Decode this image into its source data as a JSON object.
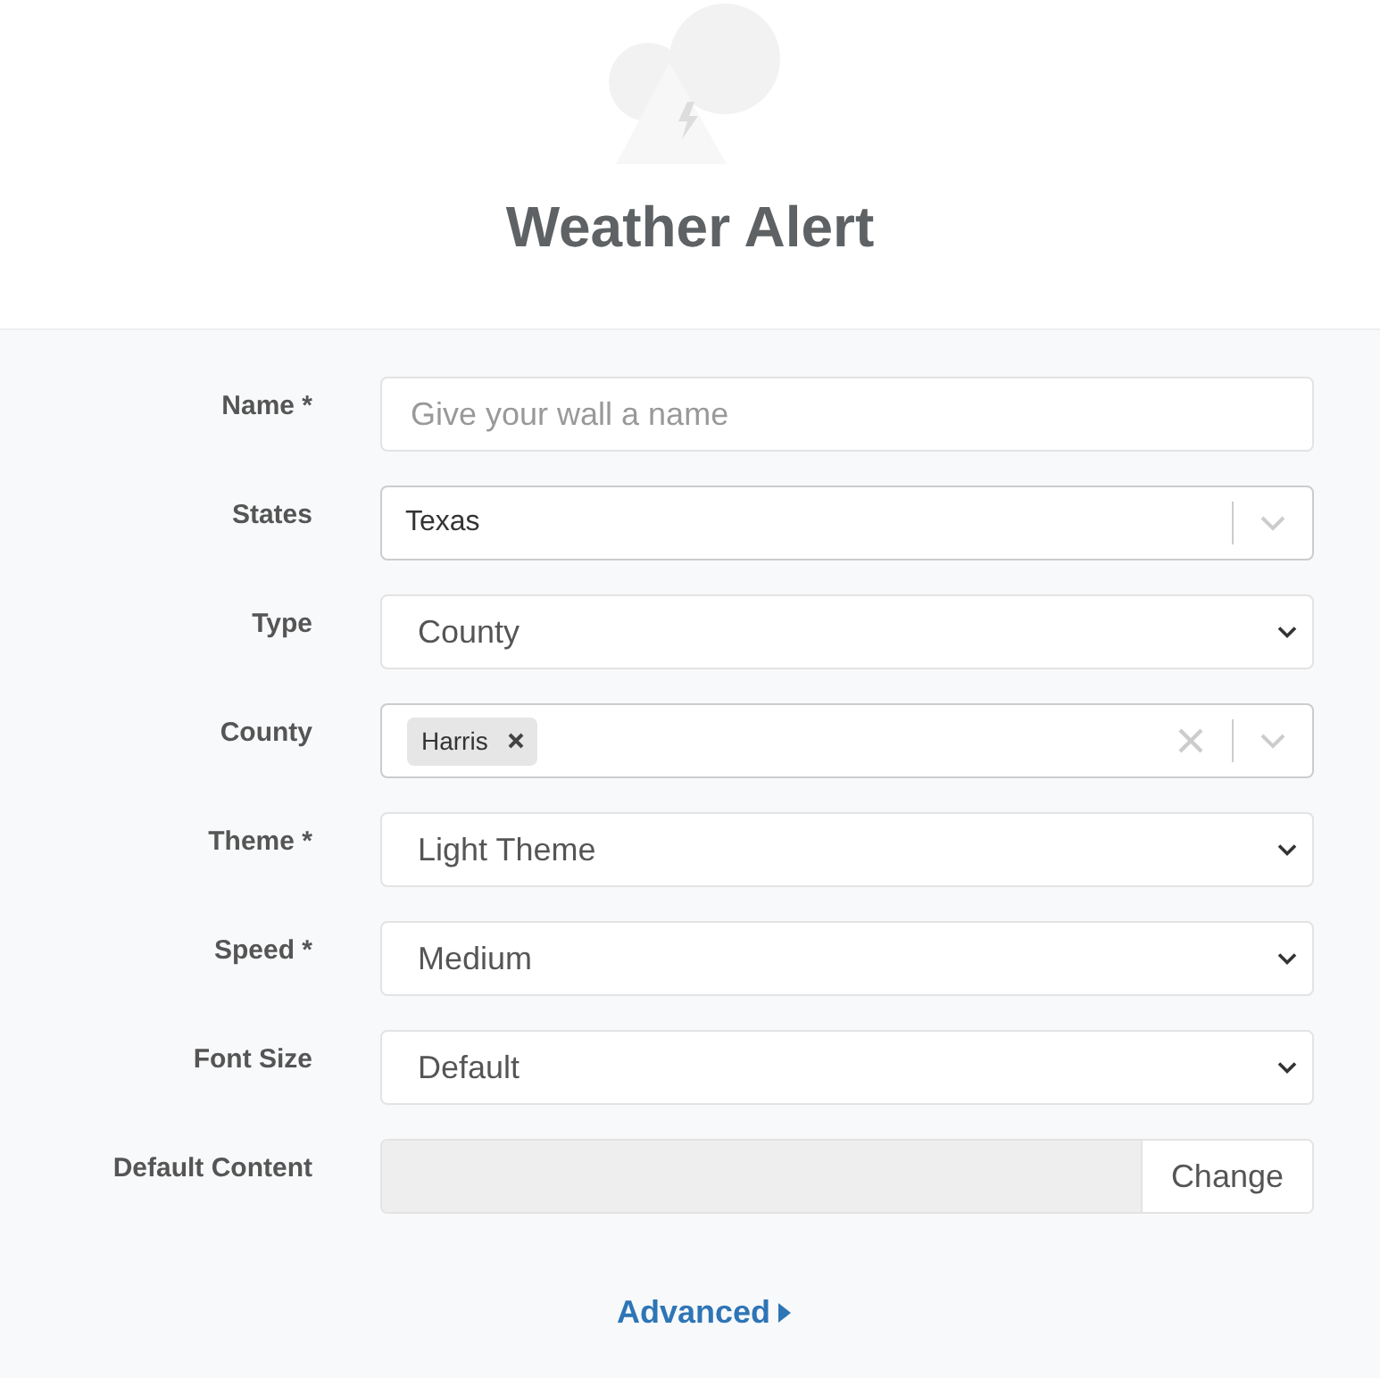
{
  "header": {
    "title": "Weather Alert"
  },
  "fields": [
    {
      "label": "Name *",
      "kind": "text",
      "placeholder": "Give your wall a name"
    },
    {
      "label": "States",
      "kind": "combo",
      "value": "Texas"
    },
    {
      "label": "Type",
      "kind": "select",
      "value": "County"
    },
    {
      "label": "County",
      "kind": "multi",
      "tags": [
        "Harris"
      ]
    },
    {
      "label": "Theme *",
      "kind": "select",
      "value": "Light Theme"
    },
    {
      "label": "Speed *",
      "kind": "select",
      "value": "Medium"
    },
    {
      "label": "Font Size",
      "kind": "select",
      "value": "Default"
    },
    {
      "label": "Default Content",
      "kind": "file",
      "button": "Change"
    }
  ],
  "advanced_link": "Advanced"
}
